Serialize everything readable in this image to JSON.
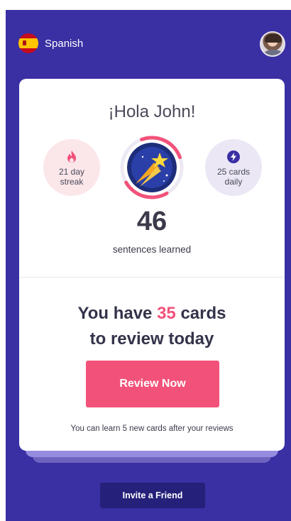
{
  "header": {
    "language_label": "Spanish",
    "flag_icon": "spain-flag-icon",
    "avatar_icon": "user-avatar"
  },
  "card": {
    "greeting": "¡Hola John!",
    "streak": {
      "line1": "21 day",
      "line2": "streak",
      "icon": "flame-icon",
      "color": "#f2527a"
    },
    "daily_cards": {
      "line1": "25 cards",
      "line2": "daily",
      "icon": "lightning-icon",
      "color": "#3a2fa3"
    },
    "badge_icon": "shooting-star-icon",
    "sentences_count": "46",
    "sentences_label": "sentences learned",
    "review_title_prefix": "You have",
    "review_count": "35",
    "review_title_suffix": "cards",
    "review_title_line2": "to review today",
    "review_button_label": "Review Now",
    "footnote": "You can learn 5 new cards after your reviews"
  },
  "invite_button_label": "Invite a Friend",
  "colors": {
    "background": "#3a2fa3",
    "accent": "#f2527a",
    "invite_button": "#25217a"
  }
}
